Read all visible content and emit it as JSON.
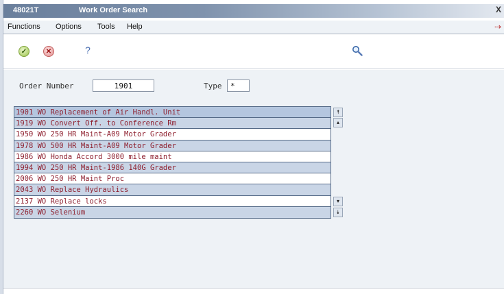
{
  "window": {
    "program": "48021T",
    "title": "Work Order Search",
    "close_glyph": "X"
  },
  "menu": [
    "Functions",
    "Options",
    "Tools",
    "Help"
  ],
  "toolbar": {
    "ok_glyph": "✓",
    "cancel_glyph": "✕",
    "help_glyph": "?",
    "icons": [
      "check-icon",
      "cancel-icon",
      "help-icon",
      "search-icon"
    ]
  },
  "form": {
    "order_label": "Order Number",
    "order_value": "1901",
    "type_label": "Type",
    "type_value": "*"
  },
  "list": {
    "rows": [
      "1901 WO Replacement of Air Handl. Unit",
      "1919 WO Convert Off. to Conference Rm",
      "1950 WO 250 HR Maint-A09 Motor Grader",
      "1978 WO 500 HR Maint-A09 Motor Grader",
      "1986 WO Honda Accord 3000 mile maint",
      "1994 WO 250 HR Maint-1986 140G Grader",
      "2006 WO 250 HR Maint Proc",
      "2043 WO Replace Hydraulics",
      "2137 WO Replace locks",
      "2260 WO Selenium"
    ]
  },
  "colors": {
    "title_bar": "#6a7f9c",
    "list_text": "#8e1f2e",
    "list_alt_row": "#c9d5e6",
    "form_background": "#eef2f6"
  }
}
